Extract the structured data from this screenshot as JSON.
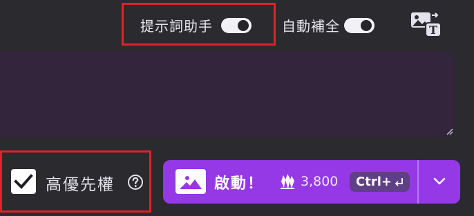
{
  "toolbar": {
    "hint_assistant": {
      "label": "提示詞助手",
      "enabled": true
    },
    "auto_complete": {
      "label": "自動補全",
      "enabled": true
    },
    "image_to_text_icon": "image-to-text-icon"
  },
  "prompt": {
    "value": "",
    "resize_icon": "resize-grip-icon"
  },
  "priority": {
    "label": "高優先權",
    "checked": true,
    "help_icon": "question-circle-icon"
  },
  "launch": {
    "label": "啟動！",
    "credits": "3,800",
    "shortcut": "Ctrl+",
    "image_icon": "image-icon",
    "credits_icon": "crystals-icon",
    "dropdown_icon": "chevron-down-icon"
  },
  "colors": {
    "background": "#2b2a2f",
    "prompt_background": "#33253c",
    "accent": "#9538e6",
    "highlight": "#e0222a",
    "chip": "#5f3f86"
  }
}
